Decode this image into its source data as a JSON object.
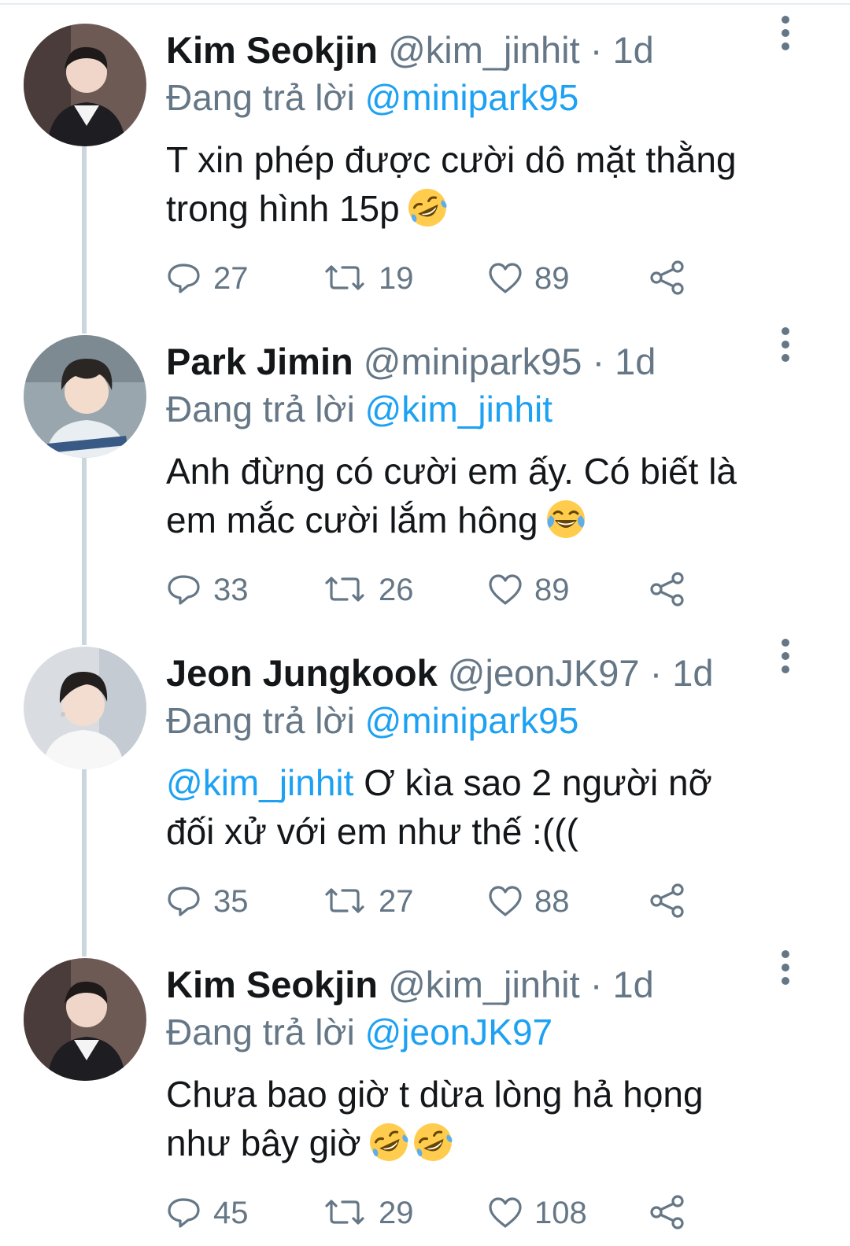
{
  "colors": {
    "accent": "#1da1f2",
    "text_primary": "#14171a",
    "text_secondary": "#657786",
    "thread_line": "#ccd6dd"
  },
  "icons": {
    "reply": "reply-icon",
    "retweet": "retweet-icon",
    "like": "heart-icon",
    "share": "share-icon",
    "more": "more-vertical-icon"
  },
  "tweets": [
    {
      "name": "Kim Seokjin",
      "handle": "@kim_jinhit",
      "separator": "·",
      "time": "1d",
      "reply_prefix": "Đang trả lời",
      "reply_to": "@minipark95",
      "body_mention": "",
      "body_line1": "T xin phép được cười dô mặt thằng",
      "body_line2": "trong hình 15p",
      "emojis": [
        "rolling-on-floor-laughing"
      ],
      "replies": "27",
      "retweets": "19",
      "likes": "89"
    },
    {
      "name": "Park Jimin",
      "handle": "@minipark95",
      "separator": "·",
      "time": "1d",
      "reply_prefix": "Đang trả lời",
      "reply_to": "@kim_jinhit",
      "body_mention": "",
      "body_line1": "Anh đừng có cười em ấy. Có biết là",
      "body_line2": "em mắc cười lắm hông",
      "emojis": [
        "face-with-tears-of-joy"
      ],
      "replies": "33",
      "retweets": "26",
      "likes": "89"
    },
    {
      "name": "Jeon Jungkook",
      "handle": "@jeonJK97",
      "separator": "·",
      "time": "1d",
      "reply_prefix": "Đang trả lời",
      "reply_to": "@minipark95",
      "body_mention": "@kim_jinhit",
      "body_line1": " Ơ kìa sao 2 người nỡ",
      "body_line2": "đối xử với em như thế :(((",
      "emojis": [],
      "replies": "35",
      "retweets": "27",
      "likes": "88"
    },
    {
      "name": "Kim Seokjin",
      "handle": "@kim_jinhit",
      "separator": "·",
      "time": "1d",
      "reply_prefix": "Đang trả lời",
      "reply_to": "@jeonJK97",
      "body_mention": "",
      "body_line1": "Chưa bao giờ t dừa lòng hả họng",
      "body_line2": "như bây giờ",
      "emojis": [
        "rolling-on-floor-laughing",
        "rolling-on-floor-laughing"
      ],
      "replies": "45",
      "retweets": "29",
      "likes": "108"
    }
  ]
}
